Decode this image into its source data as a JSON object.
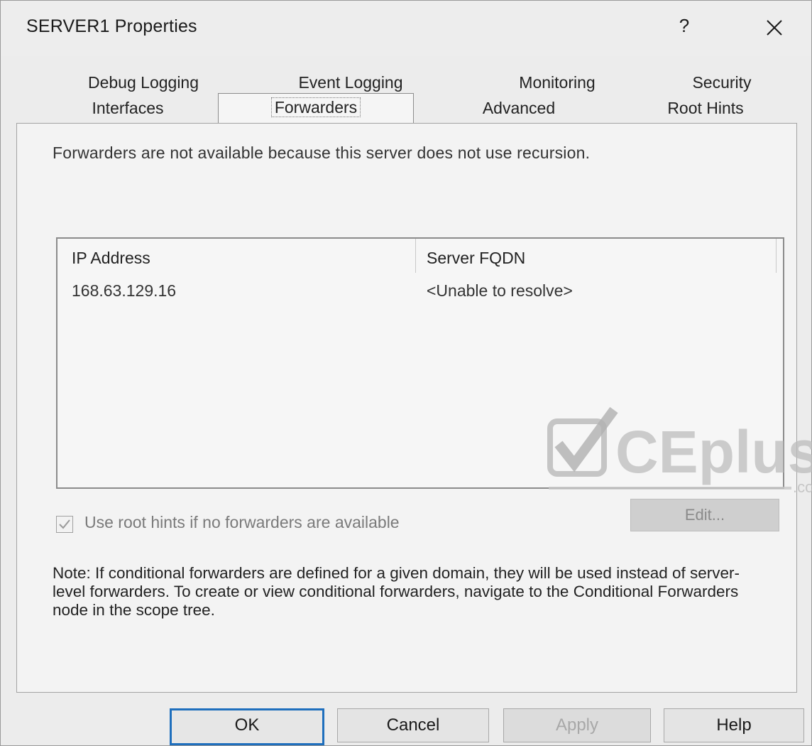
{
  "window": {
    "title": "SERVER1 Properties",
    "help_glyph": "?",
    "close_icon": "close-icon"
  },
  "tabs": {
    "row1": [
      "Debug Logging",
      "Event Logging",
      "Monitoring",
      "Security"
    ],
    "row2": [
      "Interfaces",
      "Forwarders",
      "Advanced",
      "Root Hints"
    ],
    "active": "Forwarders"
  },
  "forwarders": {
    "info": "Forwarders are not available because this server does not use recursion.",
    "columns": [
      "IP Address",
      "Server FQDN"
    ],
    "rows": [
      [
        "168.63.129.16",
        "<Unable to resolve>"
      ]
    ],
    "use_root_hints_label": "Use root hints if no forwarders are available",
    "use_root_hints_checked": true,
    "edit_label": "Edit...",
    "note": "Note: If conditional forwarders are defined for a given domain, they will be used instead of server-level forwarders.  To create or view conditional forwarders, navigate to the Conditional Forwarders node in the scope tree."
  },
  "buttons": {
    "ok": "OK",
    "cancel": "Cancel",
    "apply": "Apply",
    "help": "Help"
  },
  "watermark": {
    "brand": "CEplus",
    "suffix": ".co"
  }
}
